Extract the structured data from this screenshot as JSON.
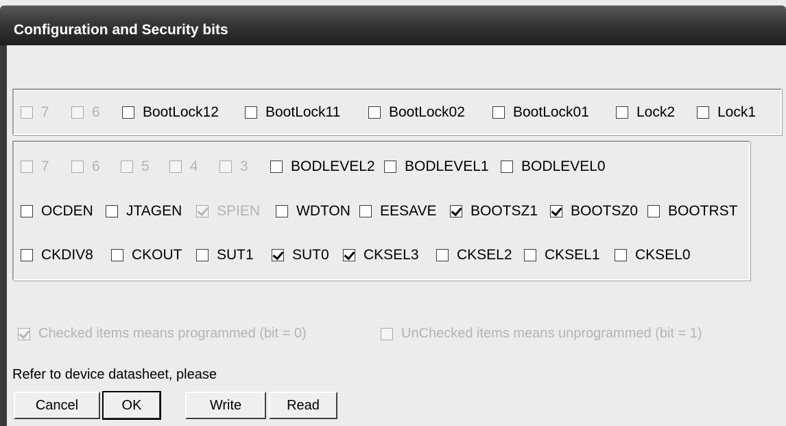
{
  "window": {
    "title": "Configuration and Security bits"
  },
  "lock_bits": [
    {
      "label": "7",
      "checked": false,
      "enabled": false
    },
    {
      "label": "6",
      "checked": false,
      "enabled": false
    },
    {
      "label": "BootLock12",
      "checked": false,
      "enabled": true
    },
    {
      "label": "BootLock11",
      "checked": false,
      "enabled": true
    },
    {
      "label": "BootLock02",
      "checked": false,
      "enabled": true
    },
    {
      "label": "BootLock01",
      "checked": false,
      "enabled": true
    },
    {
      "label": "Lock2",
      "checked": false,
      "enabled": true
    },
    {
      "label": "Lock1",
      "checked": false,
      "enabled": true
    }
  ],
  "fuse_rows": [
    [
      {
        "label": "7",
        "checked": false,
        "enabled": false
      },
      {
        "label": "6",
        "checked": false,
        "enabled": false
      },
      {
        "label": "5",
        "checked": false,
        "enabled": false
      },
      {
        "label": "4",
        "checked": false,
        "enabled": false
      },
      {
        "label": "3",
        "checked": false,
        "enabled": false
      },
      {
        "label": "BODLEVEL2",
        "checked": false,
        "enabled": true
      },
      {
        "label": "BODLEVEL1",
        "checked": false,
        "enabled": true
      },
      {
        "label": "BODLEVEL0",
        "checked": false,
        "enabled": true
      }
    ],
    [
      {
        "label": "OCDEN",
        "checked": false,
        "enabled": true
      },
      {
        "label": "JTAGEN",
        "checked": false,
        "enabled": true
      },
      {
        "label": "SPIEN",
        "checked": true,
        "enabled": false
      },
      {
        "label": "WDTON",
        "checked": false,
        "enabled": true
      },
      {
        "label": "EESAVE",
        "checked": false,
        "enabled": true
      },
      {
        "label": "BOOTSZ1",
        "checked": true,
        "enabled": true
      },
      {
        "label": "BOOTSZ0",
        "checked": true,
        "enabled": true
      },
      {
        "label": "BOOTRST",
        "checked": false,
        "enabled": true
      }
    ],
    [
      {
        "label": "CKDIV8",
        "checked": false,
        "enabled": true
      },
      {
        "label": "CKOUT",
        "checked": false,
        "enabled": true
      },
      {
        "label": "SUT1",
        "checked": false,
        "enabled": true
      },
      {
        "label": "SUT0",
        "checked": true,
        "enabled": true
      },
      {
        "label": "CKSEL3",
        "checked": true,
        "enabled": true
      },
      {
        "label": "CKSEL2",
        "checked": false,
        "enabled": true
      },
      {
        "label": "CKSEL1",
        "checked": false,
        "enabled": true
      },
      {
        "label": "CKSEL0",
        "checked": false,
        "enabled": true
      }
    ]
  ],
  "legend": {
    "checked": {
      "label": "Checked items means programmed (bit = 0)",
      "checked": true,
      "enabled": false
    },
    "unchecked": {
      "label": "UnChecked items means unprogrammed (bit = 1)",
      "checked": false,
      "enabled": false
    }
  },
  "hint": "Refer to device datasheet, please",
  "buttons": {
    "cancel": "Cancel",
    "ok": "OK",
    "write": "Write",
    "read": "Read"
  }
}
